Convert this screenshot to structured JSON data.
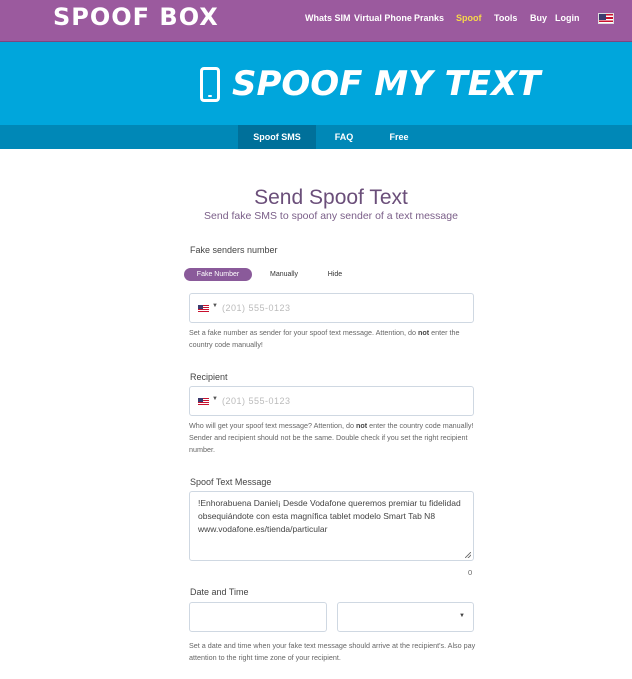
{
  "brand": {
    "logo": "SPOOF BOX"
  },
  "nav": {
    "items": [
      "Whats SIM",
      "Virtual Phone",
      "Pranks",
      "Spoof",
      "Tools",
      "Buy",
      "Login"
    ],
    "active_index": 3,
    "language_flag": "us-flag-icon"
  },
  "hero": {
    "title": "SPOOF MY TEXT",
    "icon": "phone-icon"
  },
  "subnav": {
    "tabs": [
      "Spoof SMS",
      "FAQ",
      "Free"
    ],
    "active_index": 0
  },
  "form": {
    "title": "Send Spoof Text",
    "subtitle": "Send fake SMS to spoof any sender of a text message",
    "sender": {
      "label": "Fake senders number",
      "options": [
        "Fake Number",
        "Manually",
        "Hide"
      ],
      "selected_index": 0,
      "placeholder": "(201) 555-0123",
      "country_flag": "us-flag-icon",
      "help_pre": "Set a fake number as sender for your spoof text message. Attention, do ",
      "help_bold": "not",
      "help_post": " enter the country code manually!"
    },
    "recipient": {
      "label": "Recipient",
      "placeholder": "(201) 555-0123",
      "country_flag": "us-flag-icon",
      "help_pre": "Who will get your spoof text message? Attention, do ",
      "help_bold": "not",
      "help_post": " enter the country code manually! Sender and recipient should not be the same. Double check if you set the right recipient number."
    },
    "message": {
      "label": "Spoof Text Message",
      "value": "!Enhorabuena Daniel¡ Desde Vodafone queremos premiar tu fidelidad obsequiándote con esta magnífica tablet modelo Smart Tab N8 www.vodafone.es/tienda/particular",
      "char_count": "0"
    },
    "datetime": {
      "label": "Date and Time",
      "date_value": "",
      "time_value": "",
      "help": "Set a date and time when your fake text message should arrive at the recipient's. Also pay attention to the right time zone of your recipient."
    }
  },
  "colors": {
    "nav_bg": "#9b5a9e",
    "hero_bg": "#00a6dc",
    "subnav_bg": "#0088b7",
    "accent": "#8a5a9a",
    "active_nav": "#f7d84a"
  }
}
